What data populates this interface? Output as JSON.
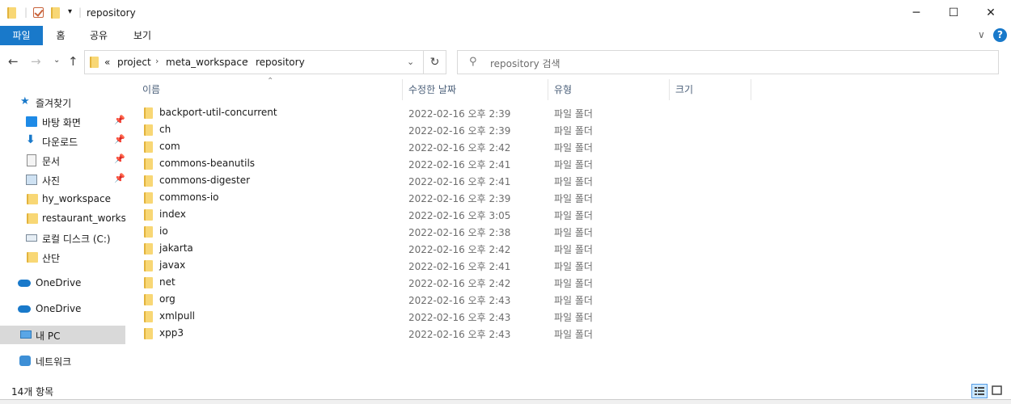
{
  "window": {
    "title": "repository"
  },
  "ribbon": {
    "tabs": [
      "파일",
      "홈",
      "공유",
      "보기"
    ]
  },
  "address": {
    "overflow": "«",
    "crumbs": [
      "project",
      "meta_workspace",
      "repository"
    ]
  },
  "search": {
    "placeholder": "repository 검색"
  },
  "nav": {
    "quick_access": "즐겨찾기",
    "items": [
      "바탕 화면",
      "다운로드",
      "문서",
      "사진",
      "hy_workspace",
      "restaurant_workspace",
      "로컬 디스크 (C:)",
      "산단"
    ],
    "onedrive1": "OneDrive",
    "onedrive2": "OneDrive",
    "this_pc": "내 PC",
    "network": "네트워크"
  },
  "columns": {
    "name": "이름",
    "date": "수정한 날짜",
    "type": "유형",
    "size": "크기"
  },
  "files": [
    {
      "name": "backport-util-concurrent",
      "date": "2022-02-16 오후 2:39",
      "type": "파일 폴더"
    },
    {
      "name": "ch",
      "date": "2022-02-16 오후 2:39",
      "type": "파일 폴더"
    },
    {
      "name": "com",
      "date": "2022-02-16 오후 2:42",
      "type": "파일 폴더"
    },
    {
      "name": "commons-beanutils",
      "date": "2022-02-16 오후 2:41",
      "type": "파일 폴더"
    },
    {
      "name": "commons-digester",
      "date": "2022-02-16 오후 2:41",
      "type": "파일 폴더"
    },
    {
      "name": "commons-io",
      "date": "2022-02-16 오후 2:39",
      "type": "파일 폴더"
    },
    {
      "name": "index",
      "date": "2022-02-16 오후 3:05",
      "type": "파일 폴더"
    },
    {
      "name": "io",
      "date": "2022-02-16 오후 2:38",
      "type": "파일 폴더"
    },
    {
      "name": "jakarta",
      "date": "2022-02-16 오후 2:42",
      "type": "파일 폴더"
    },
    {
      "name": "javax",
      "date": "2022-02-16 오후 2:41",
      "type": "파일 폴더"
    },
    {
      "name": "net",
      "date": "2022-02-16 오후 2:42",
      "type": "파일 폴더"
    },
    {
      "name": "org",
      "date": "2022-02-16 오후 2:43",
      "type": "파일 폴더"
    },
    {
      "name": "xmlpull",
      "date": "2022-02-16 오후 2:43",
      "type": "파일 폴더"
    },
    {
      "name": "xpp3",
      "date": "2022-02-16 오후 2:43",
      "type": "파일 폴더"
    }
  ],
  "status": {
    "count": "14개 항목"
  },
  "colors": {
    "accent": "#1979ca",
    "folder": "#f8d775",
    "selection": "#d9d9d9"
  }
}
